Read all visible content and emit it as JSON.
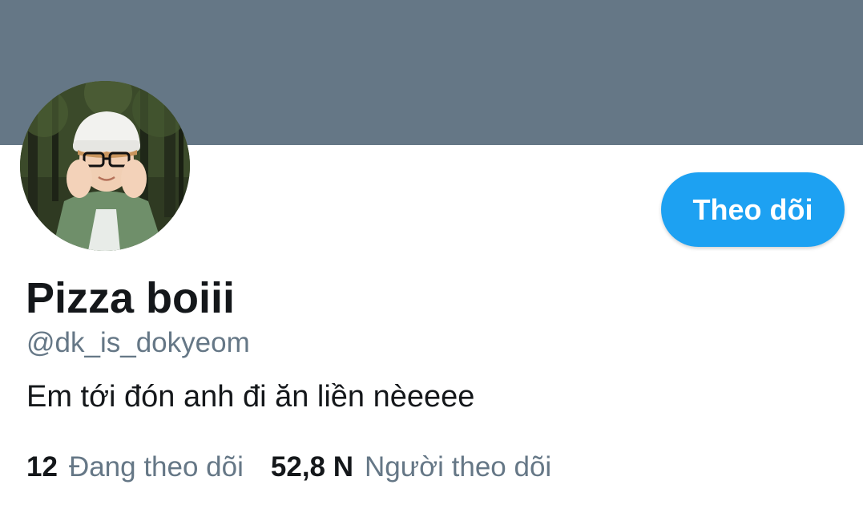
{
  "profile": {
    "banner_color": "#657786",
    "avatar": "profile-photo",
    "display_name": "Pizza boiii",
    "handle": "@dk_is_dokyeom",
    "bio": "Em tới đón anh đi ăn liền nèeeee",
    "follow_label": "Theo dõi",
    "accent_color": "#1da1f2"
  },
  "stats": {
    "following_count": "12",
    "following_label": "Đang theo dõi",
    "followers_count": "52,8 N",
    "followers_label": "Người theo dõi"
  }
}
